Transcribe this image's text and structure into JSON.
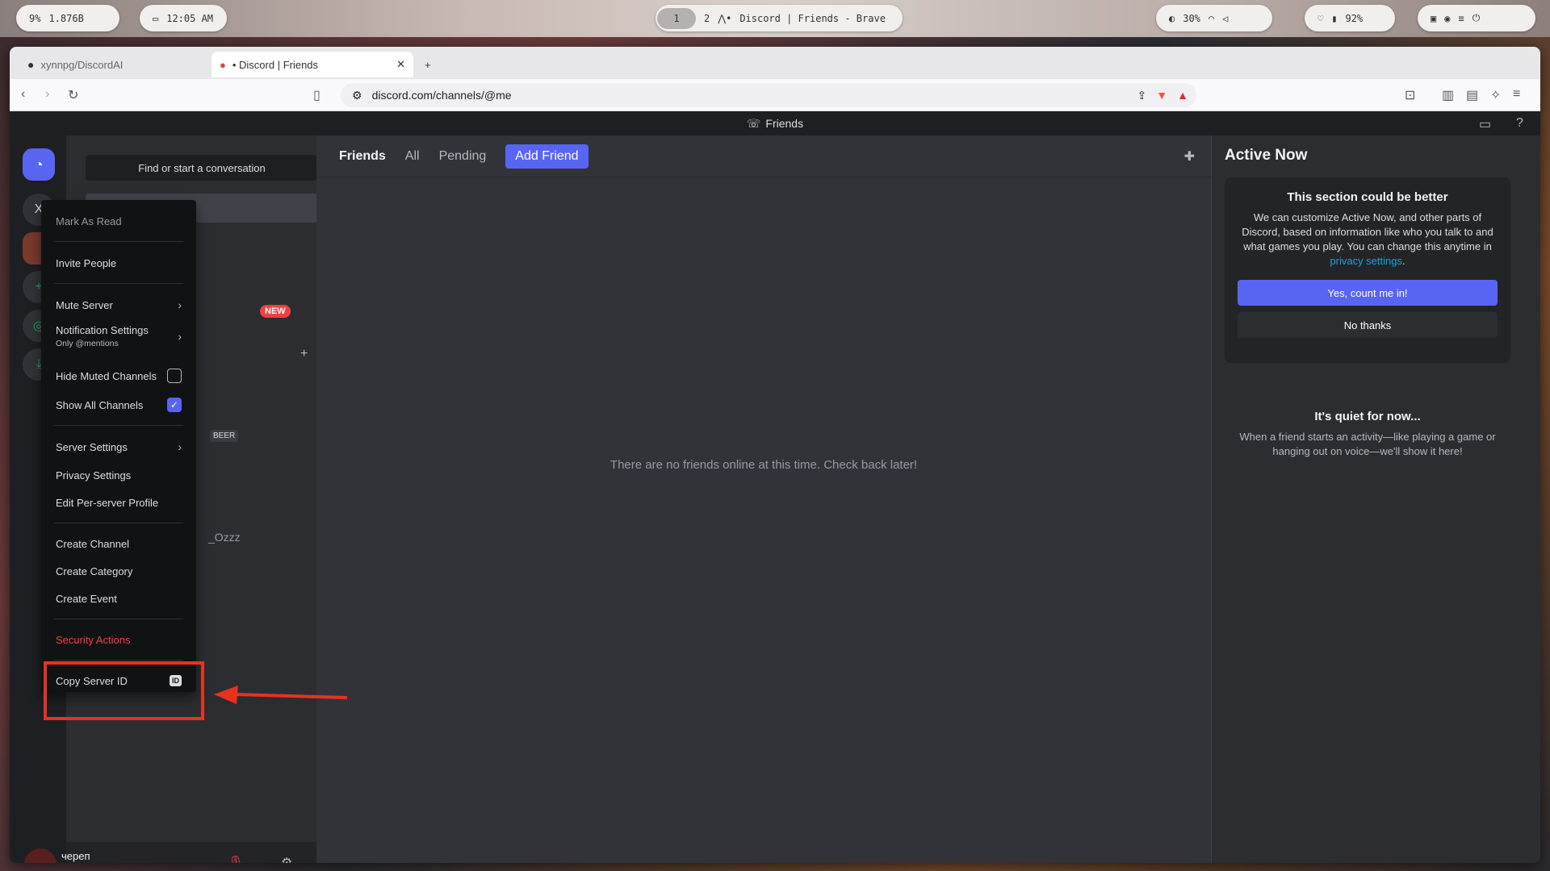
{
  "sysbar": {
    "cpu": "9%",
    "mem": "1.876B",
    "time": "12:05 AM",
    "workspace_active": "1",
    "workspace_other": "2",
    "window_title": "Discord | Friends - Brave",
    "brightness": "30%",
    "battery": "92%"
  },
  "browser": {
    "tabs": [
      {
        "label": "xynnpg/DiscordAI"
      },
      {
        "label": "• Discord | Friends"
      }
    ],
    "url": "discord.com/channels/@me",
    "notif_count": "1"
  },
  "discord": {
    "titlebar": "Friends",
    "search_placeholder": "Find or start a conversation",
    "sidebar_friends": "Friends",
    "new_badge": "NEW",
    "partial_label_beer": "BEER",
    "partial_label_ozzz": "_Ozzz",
    "server_initial": "X",
    "header": {
      "friends": "Friends",
      "all": "All",
      "pending": "Pending",
      "add_friend": "Add Friend"
    },
    "empty_message": "There are no friends online at this time. Check back later!",
    "active_now": {
      "title": "Active Now",
      "card_title": "This section could be better",
      "card_body": "We can customize Active Now, and other parts of Discord, based on information like who you talk to and what games you play. You can change this anytime in",
      "card_link": "privacy settings",
      "card_period": ".",
      "yes_btn": "Yes, count me in!",
      "no_btn": "No thanks",
      "quiet_title": "It's quiet for now...",
      "quiet_body": "When a friend starts an activity—like playing a game or hanging out on voice—we'll show it here!"
    },
    "user": {
      "name": "череп",
      "status": "👀"
    }
  },
  "menu": {
    "mark_as_read": "Mark As Read",
    "invite_people": "Invite People",
    "mute_server": "Mute Server",
    "notification_settings": "Notification Settings",
    "notification_sub": "Only @mentions",
    "hide_muted": "Hide Muted Channels",
    "hide_muted_checked": false,
    "show_all": "Show All Channels",
    "show_all_checked": true,
    "server_settings": "Server Settings",
    "privacy_settings": "Privacy Settings",
    "edit_profile": "Edit Per-server Profile",
    "create_channel": "Create Channel",
    "create_category": "Create Category",
    "create_event": "Create Event",
    "security_actions": "Security Actions",
    "copy_server_id": "Copy Server ID",
    "id_badge": "ID"
  },
  "colors": {
    "blurple": "#5865f2",
    "danger": "#f23f43",
    "highlight": "#e8321f",
    "link": "#00a8fc"
  }
}
